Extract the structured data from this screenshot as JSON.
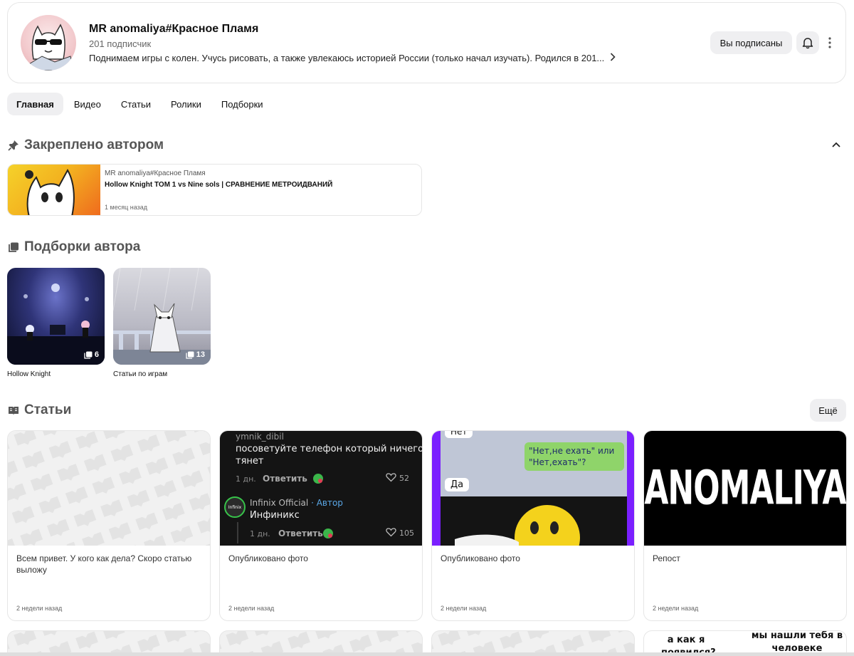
{
  "channel": {
    "name": "MR anomaliya#Красное Пламя",
    "subscribers": "201 подписчик",
    "description": "Поднимаем игры с колен. Учусь рисовать, а также увлекаюсь историей России (только начал изучать). Родился в 201...",
    "subscribed_label": "Вы подписаны"
  },
  "tabs": [
    {
      "label": "Главная",
      "active": true
    },
    {
      "label": "Видео"
    },
    {
      "label": "Статьи"
    },
    {
      "label": "Ролики"
    },
    {
      "label": "Подборки"
    }
  ],
  "pinned": {
    "heading": "Закреплено автором",
    "author": "MR anomaliya#Красное Пламя",
    "title": "Hollow Knight TOM 1 vs Nine sols | СРАВНЕНИЕ МЕТРОИДВАНИЙ",
    "time": "1 месяц назад"
  },
  "collections": {
    "heading": "Подборки автора",
    "items": [
      {
        "label": "Hollow Knight",
        "count": "6"
      },
      {
        "label": "Статьи по играм",
        "count": "13"
      }
    ]
  },
  "articles": {
    "heading": "Статьи",
    "more_label": "Ещё",
    "items": [
      {
        "text": "Всем привет. У кого как дела? Скоро статью выложу",
        "time": "2 недели назад"
      },
      {
        "text": "Опубликовано фото",
        "time": "2 недели назад"
      },
      {
        "text": "Опубликовано фото",
        "time": "2 недели назад"
      },
      {
        "text": "Репост",
        "time": "2 недели назад"
      }
    ],
    "comment_shot": {
      "user1": "ymnik_dibil",
      "comment1": "посоветуйте телефон который ничего н",
      "comment1b": "тянет",
      "age": "1 дн.",
      "reply": "Ответить",
      "likes1": "52",
      "user2": "Infinix Official",
      "author_tag": "· Автор",
      "comment2": "Инфиникс",
      "likes2": "105",
      "logo_text": "Infinix"
    },
    "chat_shot": {
      "top": "Нет",
      "bubble": "\"Нет,не ехать\" или \"Нет,ехать\"?",
      "answer": "Да"
    },
    "repost_logo": "ANOMALIYA",
    "bottom_meme": {
      "left": "а как я появился?",
      "right": "мы нашли тебя в человеке"
    }
  },
  "colors": {
    "accent_bg": "#efeff1",
    "border": "#e6e6e6",
    "chat_bubble": "#8fd46a",
    "purple": "#7a1fff"
  }
}
